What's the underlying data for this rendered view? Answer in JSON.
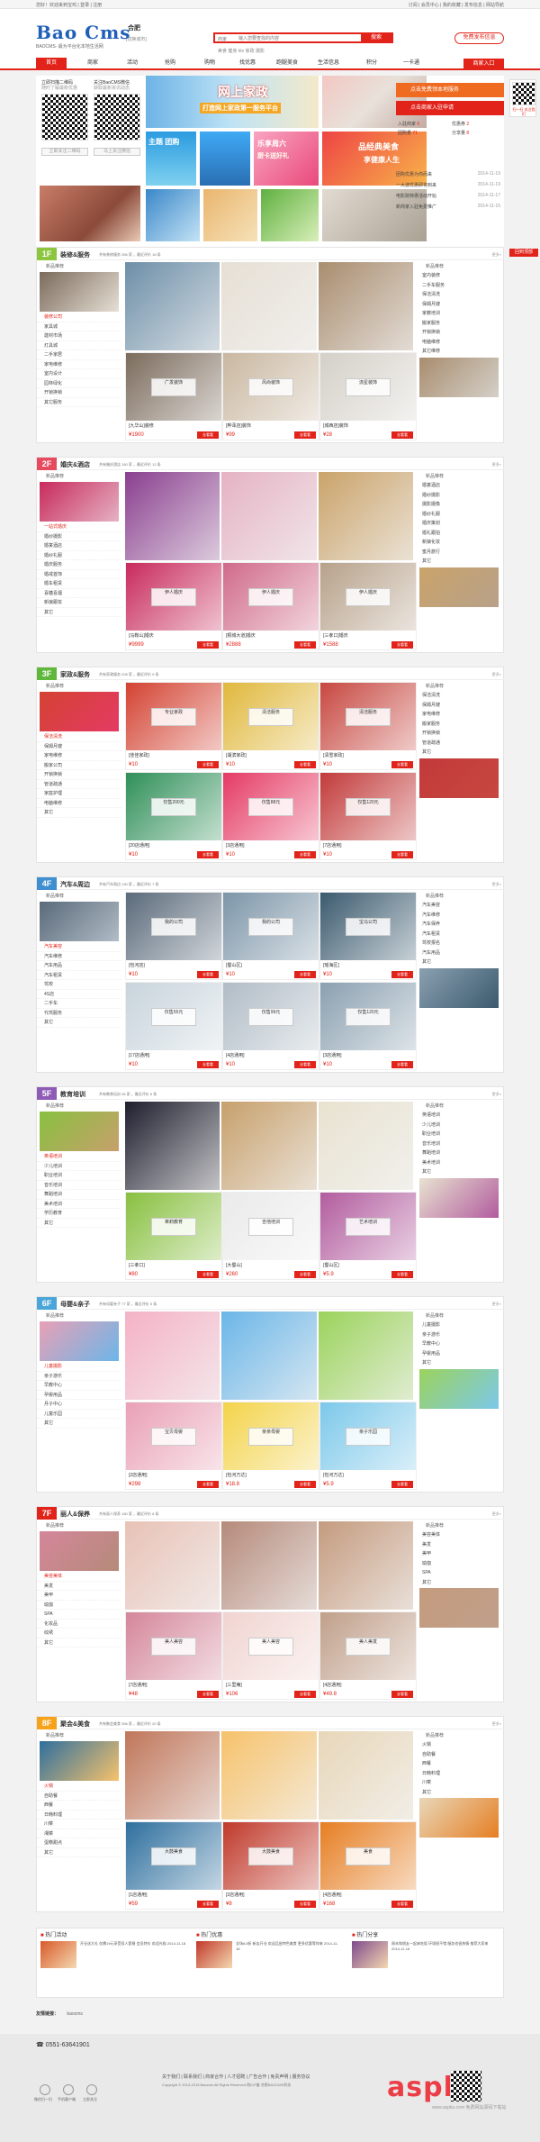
{
  "topbar": {
    "left": "您好！欢迎来到宝鸡 | 登录 | 注册",
    "right": "订阅 | 会员中心 | 我的收藏 | 发布信息 | 网站导航"
  },
  "header": {
    "logo": "Bao Cms",
    "slogan": "BAOCMS- 最为平台化本地生活网",
    "city": "合肥",
    "city_switch": "[切换城市]",
    "search_select": "商家",
    "search_placeholder": "输入您要查找的内容",
    "search_button": "搜索",
    "hotwords": "美食 健身 ktv 家政 摄影",
    "post_button": "免费发布信息"
  },
  "nav": {
    "items": [
      "首页",
      "商家",
      "活动",
      "抢购",
      "购物",
      "找优惠",
      "跑腿美食",
      "生活信息",
      "积分",
      "一卡通"
    ],
    "shop_entry": "商家入口"
  },
  "promo": {
    "qr1": "立即扫描二维码",
    "qr1b": "随时了解最新优惠",
    "qr2": "关注BaoCMS微信",
    "qr2b": "获取最新资讯动态",
    "btn1": "立即关注二维码",
    "btn2": "马上关注微信",
    "ban_main": "网上家政",
    "ban_main2": "打造网上家政第一服务平台",
    "ban_a": "主题 团购",
    "ban_b": "乐享周六",
    "ban_b2": "厨卡送好礼",
    "ban_c": "品经典美食",
    "ban_c2": "享健康人生"
  },
  "rside": {
    "btn1": "点击免费领本地服务",
    "btn2": "点击商家入驻申请",
    "stats": [
      {
        "t": "入驻商家",
        "v": "6"
      },
      {
        "t": "优惠券",
        "v": "2"
      },
      {
        "t": "团购量",
        "v": "71"
      },
      {
        "t": "分享量",
        "v": "8"
      }
    ],
    "news": [
      {
        "t": "团购优惠为你而来",
        "d": "2014-11-19"
      },
      {
        "t": "一大波优惠即将到来",
        "d": "2014-11-19"
      },
      {
        "t": "电影院特惠活动开始",
        "d": "2014-11-17"
      },
      {
        "t": "新商家入驻免费推广",
        "d": "2014-11-15"
      }
    ],
    "float": "扫一扫 关注我们",
    "float_btn": "回到顶部"
  },
  "floors": [
    {
      "num": "1F",
      "title": "装修&服务",
      "info": "共有装修服务 356 家 ，最近评价 18 条",
      "color": "#8cc63f",
      "left": [
        "新品推荐",
        "装修公司",
        "家具城",
        "建材市场",
        "灯具城",
        "二手家居",
        "家电维修",
        "室内设计",
        "园林绿化",
        "开锁换锁",
        "其它服务"
      ],
      "cards": [
        {
          "tt": "[九华山]装修",
          "ov": "广发装饰",
          "pr": "1900"
        },
        {
          "tt": "[桦泽店]装饰",
          "ov": "风尚装饰",
          "pr": "99"
        },
        {
          "tt": "[城西店]装饰",
          "ov": "流星装饰",
          "pr": "28"
        }
      ],
      "right": [
        "新品推荐",
        "室内装修",
        "二手车服务",
        "保洁清洗",
        "保姆月嫂",
        "家教培训",
        "搬家服务",
        "开锁换锁",
        "电脑维修",
        "其它维修"
      ]
    },
    {
      "num": "2F",
      "title": "婚庆&酒店",
      "info": "共有婚庆酒店 160 家 ，最近评价 12 条",
      "color": "#e64a5f",
      "left": [
        "新品推荐",
        "一站式婚庆",
        "婚纱摄影",
        "婚宴酒店",
        "婚纱礼服",
        "婚庆服务",
        "婚戒首饰",
        "婚车租赁",
        "喜糖喜烟",
        "新娘跟妆",
        "其它"
      ],
      "cards": [
        {
          "tt": "[马鞍山]婚庆",
          "ov": "伊人婚庆",
          "pr": "9999"
        },
        {
          "tt": "[桐城大道]婚庆",
          "ov": "伊人婚庆",
          "pr": "2888"
        },
        {
          "tt": "[三孝口]婚庆",
          "ov": "伊人婚庆",
          "pr": "1588"
        }
      ],
      "right": [
        "新品推荐",
        "婚宴酒店",
        "婚纱摄影",
        "摄影摄像",
        "婚纱礼服",
        "婚庆策划",
        "婚礼跟拍",
        "新娘化妆",
        "蜜月旅行",
        "其它"
      ]
    },
    {
      "num": "3F",
      "title": "家政&服务",
      "info": "共有家政服务 208 家 ，最近评价 9 条",
      "color": "#5fb83c",
      "left": [
        "新品推荐",
        "保洁清洗",
        "保姆月嫂",
        "家电维修",
        "搬家公司",
        "开锁换锁",
        "管道疏通",
        "家庭护理",
        "电脑维修",
        "其它"
      ],
      "cards": [
        {
          "tt": "[佳佳家政]",
          "ov": "专业家政",
          "pr": "10"
        },
        {
          "tt": "[湖滨家政]",
          "ov": "清洁服务",
          "pr": "10"
        },
        {
          "tt": "[清雪家政]",
          "ov": "清洁服务",
          "pr": "10"
        },
        {
          "tt": "[20店通用]",
          "ov": "仅售200元",
          "pr": "10"
        },
        {
          "tt": "[3店通用]",
          "ov": "仅售88元",
          "pr": "10"
        },
        {
          "tt": "[7店通用]",
          "ov": "仅售120元",
          "pr": "10"
        }
      ],
      "right": [
        "新品推荐",
        "保洁清洗",
        "保姆月嫂",
        "家电维修",
        "搬家服务",
        "开锁换锁",
        "管道疏通",
        "其它"
      ]
    },
    {
      "num": "4F",
      "title": "汽车&周边",
      "info": "共有汽车周边 130 家 ，最近评价 7 条",
      "color": "#3e8ed0",
      "left": [
        "新品推荐",
        "汽车美容",
        "汽车维修",
        "汽车用品",
        "汽车租赁",
        "驾校",
        "4S店",
        "二手车",
        "代驾服务",
        "其它"
      ],
      "cards": [
        {
          "tt": "[包河店]",
          "ov": "我的公司",
          "pr": "10"
        },
        {
          "tt": "[蜀山区]",
          "ov": "我的公司",
          "pr": "10"
        },
        {
          "tt": "[瑶海区]",
          "ov": "宝马公司",
          "pr": "10"
        },
        {
          "tt": "[17店通用]",
          "ov": "仅售55元",
          "pr": "10"
        },
        {
          "tt": "[4店通用]",
          "ov": "仅售99元",
          "pr": "10"
        },
        {
          "tt": "[3店通用]",
          "ov": "仅售120元",
          "pr": "10"
        }
      ],
      "right": [
        "新品推荐",
        "汽车美容",
        "汽车维修",
        "汽车保养",
        "汽车租赁",
        "驾校报名",
        "汽车用品",
        "其它"
      ]
    },
    {
      "num": "5F",
      "title": "教育培训",
      "info": "共有教育培训 98 家 ，最近评价 6 条",
      "color": "#8e5bb5",
      "left": [
        "新品推荐",
        "英语培训",
        "少儿培训",
        "职业培训",
        "音乐培训",
        "舞蹈培训",
        "美术培训",
        "学历教育",
        "其它"
      ],
      "cards": [
        {
          "tt": "[三孝口]",
          "ov": "茉莉教育",
          "pr": "80"
        },
        {
          "tt": "[大蜀山]",
          "ov": "吉他培训",
          "pr": "260"
        },
        {
          "tt": "[蜀山区]",
          "ov": "艺术培训",
          "pr": "5.9"
        }
      ],
      "right": [
        "新品推荐",
        "英语培训",
        "少儿培训",
        "职业培训",
        "音乐培训",
        "舞蹈培训",
        "美术培训",
        "其它"
      ]
    },
    {
      "num": "6F",
      "title": "母婴&亲子",
      "info": "共有母婴亲子 77 家 ，最近评价 5 条",
      "color": "#4aa5d8",
      "left": [
        "新品推荐",
        "儿童摄影",
        "亲子游乐",
        "早教中心",
        "孕婴用品",
        "月子中心",
        "儿童乐园",
        "其它"
      ],
      "cards": [
        {
          "tt": "[2店通用]",
          "ov": "宝贝母婴",
          "pr": "298"
        },
        {
          "tt": "[包河万达]",
          "ov": "亲亲母婴",
          "pr": "18.8"
        },
        {
          "tt": "[包河万达]",
          "ov": "亲子乐园",
          "pr": "5.9"
        }
      ],
      "right": [
        "新品推荐",
        "儿童摄影",
        "亲子游乐",
        "早教中心",
        "孕婴用品",
        "其它"
      ]
    },
    {
      "num": "7F",
      "title": "丽人&保养",
      "info": "共有丽人保养 180 家 ，最近评价 8 条",
      "color": "#e2231a",
      "left": [
        "新品推荐",
        "美容美体",
        "美发",
        "美甲",
        "瑜伽",
        "SPA",
        "化妆品",
        "纹绣",
        "其它"
      ],
      "cards": [
        {
          "tt": "[7店通用]",
          "ov": "美人美容",
          "pr": "48"
        },
        {
          "tt": "[三里庵]",
          "ov": "美人美容",
          "pr": "106"
        },
        {
          "tt": "[4店通用]",
          "ov": "美人美发",
          "pr": "49.8"
        }
      ],
      "right": [
        "新品推荐",
        "美容美体",
        "美发",
        "美甲",
        "瑜伽",
        "SPA",
        "其它"
      ]
    },
    {
      "num": "8F",
      "title": "聚会&美食",
      "info": "共有聚会美食 356 家 ，最近评价 20 条",
      "color": "#f7a21b",
      "left": [
        "新品推荐",
        "火锅",
        "自助餐",
        "西餐",
        "日韩料理",
        "川菜",
        "湘菜",
        "蛋糕甜点",
        "其它"
      ],
      "cards": [
        {
          "tt": "[1店通用]",
          "ov": "大鼓美食",
          "pr": "59"
        },
        {
          "tt": "[2店通用]",
          "ov": "大鼓美食",
          "pr": "8"
        },
        {
          "tt": "[4店通用]",
          "ov": "美食",
          "pr": "168"
        }
      ],
      "right": [
        "新品推荐",
        "火锅",
        "自助餐",
        "西餐",
        "日韩料理",
        "川菜",
        "其它"
      ]
    }
  ],
  "hot": [
    {
      "h": "热门活动",
      "t": "开业送大礼 仅需19元享受双人套餐 会员特价 欢迎光临 2014-11-18"
    },
    {
      "h": "热门优惠",
      "t": "全场8.8折 新店开业 欢迎品尝特色美食 更多优惠等你来 2014-11-18"
    },
    {
      "h": "热门分享",
      "t": "周末和朋友一起来吃饭 环境很不错 服务也很热情 推荐大家来 2014-11-18"
    }
  ],
  "links": {
    "label": "友情链接：",
    "items": "baocms"
  },
  "footer": {
    "tel": "0551-63641901",
    "menu": "关于我们 | 联系我们 | 商家合作 | 人才招聘 | 广告合作 | 免责声明 | 服务协议",
    "copy": "Copyright © 2013-2015 Baocms All Rights Reserved 皖ICP备 合肥BAOCMS科技",
    "icons": [
      "微信扫一扫",
      "手机客户端",
      "立即关注"
    ]
  },
  "watermark": {
    "text": "aspku",
    "sub": "www.aspku.com 免费网站源码下载站"
  }
}
